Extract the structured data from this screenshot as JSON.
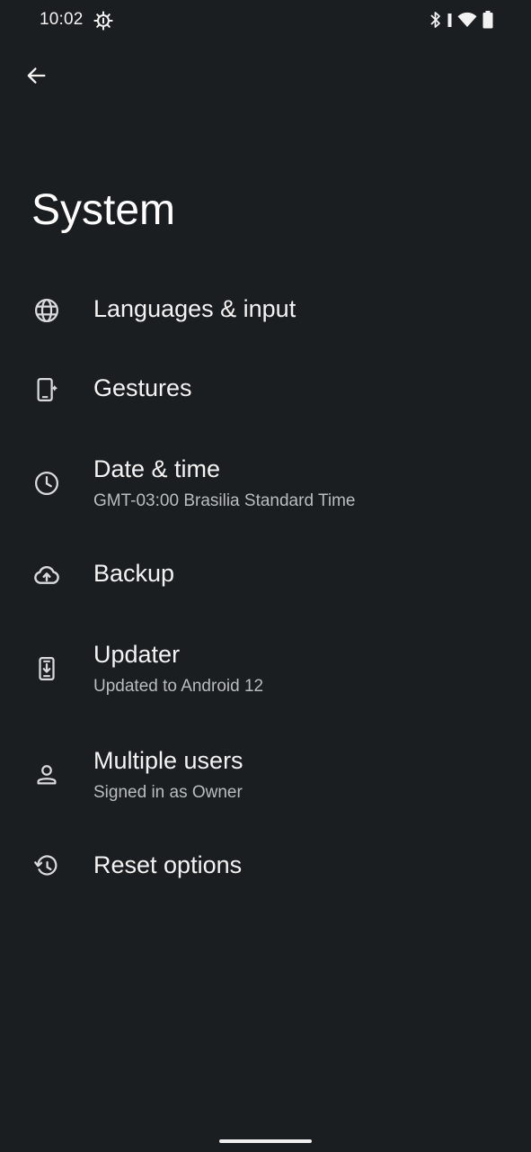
{
  "status_bar": {
    "time": "10:02",
    "icons": [
      "data-saver-icon",
      "bluetooth-icon",
      "wifi-icon",
      "battery-icon"
    ]
  },
  "header": {
    "back_icon": "arrow-back-icon",
    "title": "System"
  },
  "items": [
    {
      "icon": "globe-icon",
      "title": "Languages & input",
      "subtitle": ""
    },
    {
      "icon": "gestures-phone-icon",
      "title": "Gestures",
      "subtitle": ""
    },
    {
      "icon": "clock-icon",
      "title": "Date & time",
      "subtitle": "GMT-03:00 Brasilia Standard Time"
    },
    {
      "icon": "cloud-upload-icon",
      "title": "Backup",
      "subtitle": ""
    },
    {
      "icon": "system-update-icon",
      "title": "Updater",
      "subtitle": "Updated to Android 12"
    },
    {
      "icon": "person-icon",
      "title": "Multiple users",
      "subtitle": "Signed in as Owner"
    },
    {
      "icon": "history-icon",
      "title": "Reset options",
      "subtitle": ""
    }
  ],
  "colors": {
    "background": "#1b1e20",
    "text_primary": "#f3f3f3",
    "text_secondary": "#b9bcc0"
  }
}
